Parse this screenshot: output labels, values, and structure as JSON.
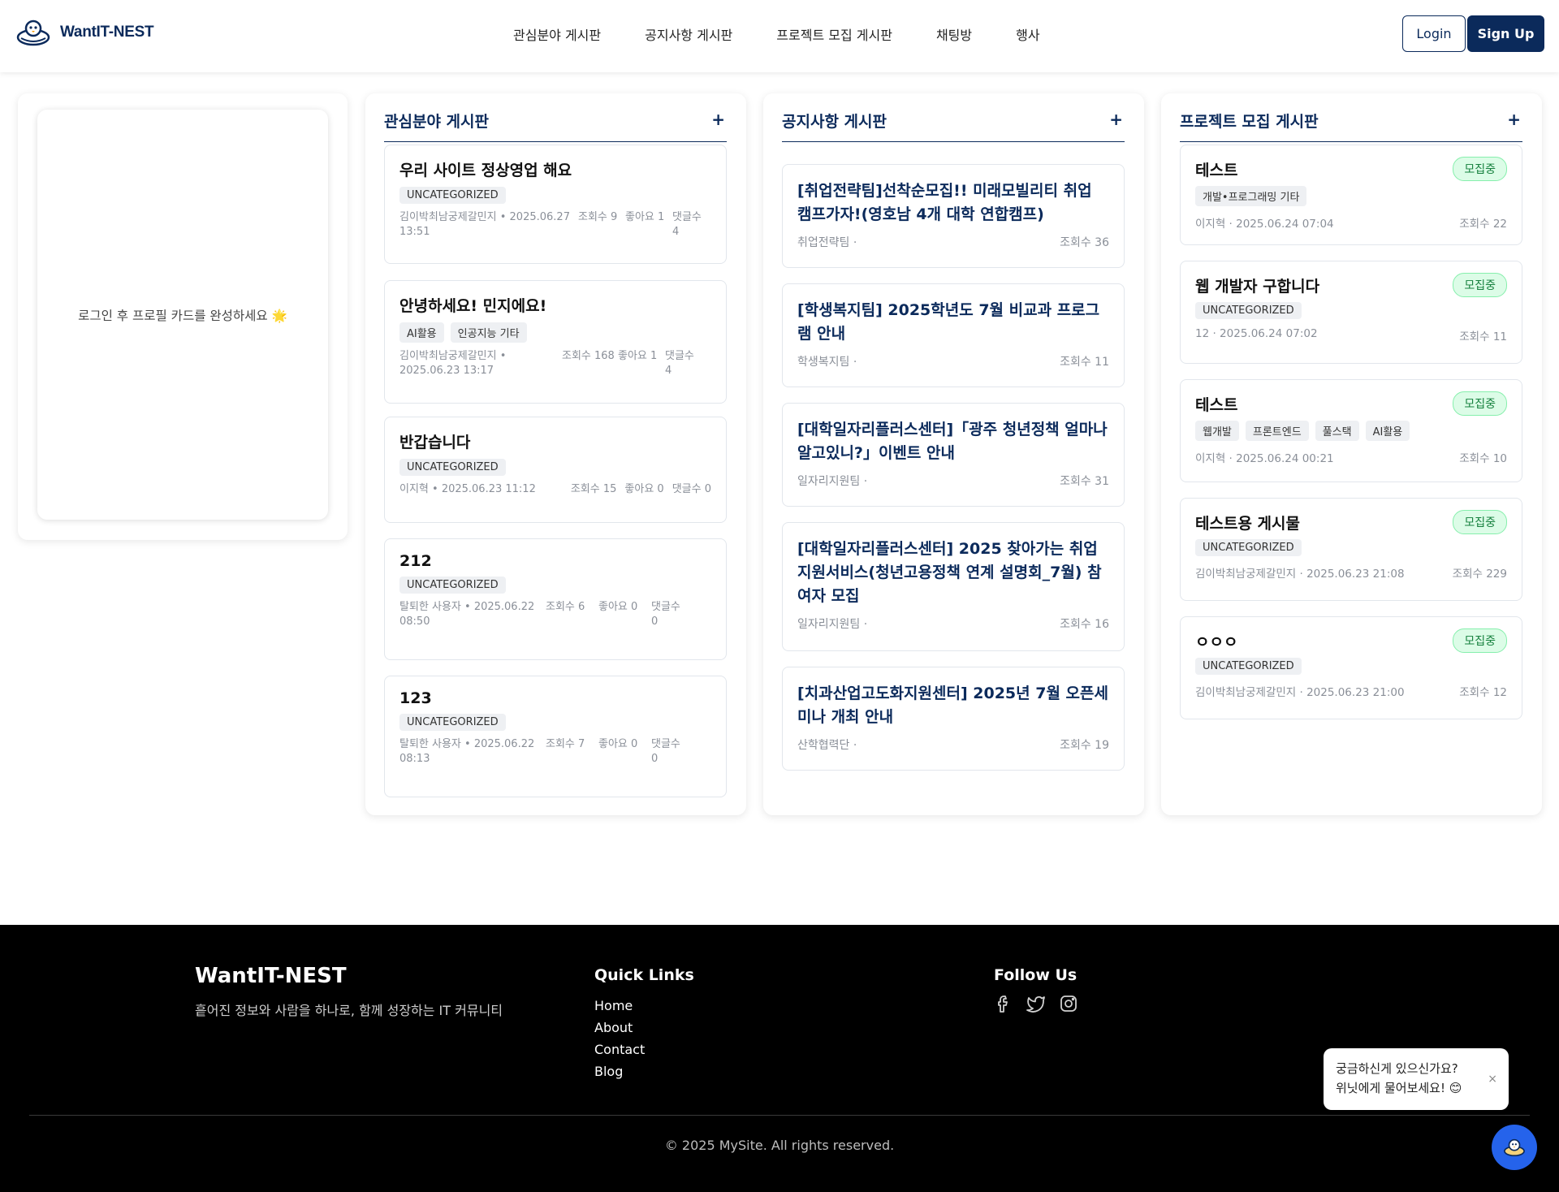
{
  "header": {
    "brand": "WantIT-NEST",
    "nav": [
      "관심분야 게시판",
      "공지사항 게시판",
      "프로젝트 모집 게시판",
      "채팅방",
      "행사"
    ],
    "login_label": "Login",
    "signup_label": "Sign Up"
  },
  "profile": {
    "message": "로그인 후 프로필 카드를 완성하세요 🌟"
  },
  "interest_board": {
    "title": "관심분야 게시판",
    "add_icon": "+",
    "posts": [
      {
        "title": "우리 사이트 정상영업 해요",
        "tags": [
          "UNCATEGORIZED"
        ],
        "author_date": "김이박최남궁제갈민지 • 2025.06.27 13:51",
        "views": "조회수 9",
        "likes": "좋아요 1",
        "comments": "댓글수 4"
      },
      {
        "title": "안녕하세요! 민지에요!",
        "tags": [
          "AI활용",
          "인공지능 기타"
        ],
        "author_date": "김이박최남궁제갈민지 • 2025.06.23 13:17",
        "views": "조회수 168",
        "likes": "좋아요 1",
        "comments": "댓글수 4"
      },
      {
        "title": "반갑습니다",
        "tags": [
          "UNCATEGORIZED"
        ],
        "author_date": "이지혁 • 2025.06.23 11:12",
        "views": "조회수 15",
        "likes": "좋아요 0",
        "comments": "댓글수 0"
      },
      {
        "title": "212",
        "tags": [
          "UNCATEGORIZED"
        ],
        "author_date": "탈퇴한 사용자 • 2025.06.22 08:50",
        "views": "조회수 6",
        "likes": "좋아요 0",
        "comments": "댓글수 0"
      },
      {
        "title": "123",
        "tags": [
          "UNCATEGORIZED"
        ],
        "author_date": "탈퇴한 사용자 • 2025.06.22 08:13",
        "views": "조회수 7",
        "likes": "좋아요 0",
        "comments": "댓글수 0"
      }
    ]
  },
  "notice_board": {
    "title": "공지사항 게시판",
    "add_icon": "+",
    "posts": [
      {
        "title": "[취업전략팀]선착순모집!! 미래모빌리티 취업 캠프가자!(영호남 4개 대학 연합캠프)",
        "team": "취업전략팀 ·",
        "views": "조회수 36"
      },
      {
        "title": "[학생복지팀] 2025학년도 7월 비교과 프로그램 안내",
        "team": "학생복지팀 ·",
        "views": "조회수 11"
      },
      {
        "title": "[대학일자리플러스센터]「광주 청년정책 얼마나 알고있니?」이벤트 안내",
        "team": "일자리지원팀 ·",
        "views": "조회수 31"
      },
      {
        "title": "[대학일자리플러스센터] 2025 찾아가는 취업지원서비스(청년고용정책 연계 설명회_7월) 참여자 모집",
        "team": "일자리지원팀 ·",
        "views": "조회수 16"
      },
      {
        "title": "[치과산업고도화지원센터] 2025년 7월 오픈세미나 개최 안내",
        "team": "산학협력단 ·",
        "views": "조회수 19"
      }
    ]
  },
  "project_board": {
    "title": "프로젝트 모집 게시판",
    "add_icon": "+",
    "posts": [
      {
        "title": "테스트",
        "badge": "모집중",
        "tags": [
          "개발•프로그래밍 기타"
        ],
        "author_date": "이지혁 · 2025.06.24 07:04",
        "views": "조회수 22"
      },
      {
        "title": "웹 개발자 구합니다",
        "badge": "모집중",
        "tags": [
          "UNCATEGORIZED"
        ],
        "author_date": "12 · 2025.06.24 07:02",
        "views": "조회수 11"
      },
      {
        "title": "테스트",
        "badge": "모집중",
        "tags": [
          "웹개발",
          "프론트엔드",
          "풀스택",
          "AI활용"
        ],
        "author_date": "이지혁 · 2025.06.24 00:21",
        "views": "조회수 10"
      },
      {
        "title": "테스트용 게시물",
        "badge": "모집중",
        "tags": [
          "UNCATEGORIZED"
        ],
        "author_date": "김이박최남궁제갈민지 · 2025.06.23 21:08",
        "views": "조회수 229"
      },
      {
        "title": "ㅇㅇㅇ",
        "badge": "모집중",
        "tags": [
          "UNCATEGORIZED"
        ],
        "author_date": "김이박최남궁제갈민지 · 2025.06.23 21:00",
        "views": "조회수 12"
      }
    ]
  },
  "footer": {
    "brand": "WantIT-NEST",
    "tagline": "흩어진 정보와 사람을 하나로, 함께 성장하는 IT 커뮤니티",
    "quick_links_title": "Quick Links",
    "links": [
      "Home",
      "About",
      "Contact",
      "Blog"
    ],
    "follow_title": "Follow Us",
    "social_icons": [
      "facebook-icon",
      "twitter-icon",
      "instagram-icon"
    ],
    "copyright": "© 2025 MySite. All rights reserved."
  },
  "chat": {
    "line1": "궁금하신게 있으신가요?",
    "line2": "위닛에게 물어보세요! 😊",
    "close": "×"
  },
  "colors": {
    "brand_navy": "#0b2a5b",
    "badge_green": "#15803d",
    "chat_blue": "#2563eb"
  }
}
